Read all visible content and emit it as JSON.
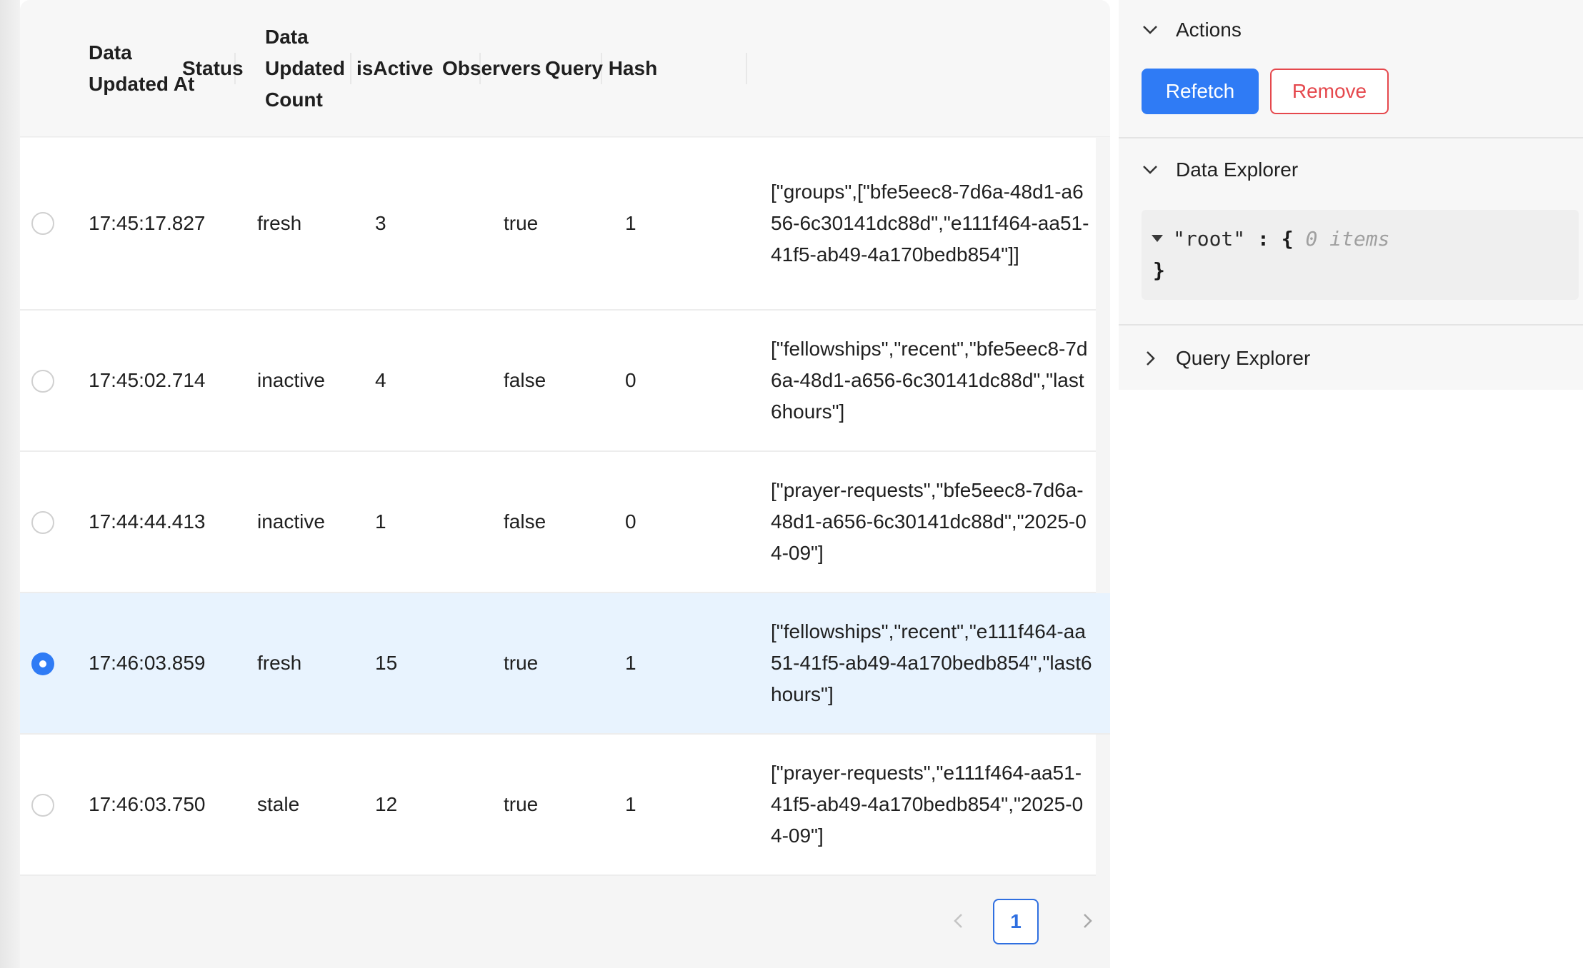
{
  "table": {
    "columns": [
      {
        "key": "updated_at",
        "label": "Data\nUpdated At"
      },
      {
        "key": "status",
        "label": "Status"
      },
      {
        "key": "count",
        "label": "Data\nUpdated\nCount"
      },
      {
        "key": "active",
        "label": "isActive"
      },
      {
        "key": "observers",
        "label": "Observers"
      },
      {
        "key": "hash",
        "label": "Query Hash"
      }
    ],
    "header": {
      "updated_at_1": "Data",
      "updated_at_2": "Updated At",
      "status": "Status",
      "count_1": "Data",
      "count_2": "Updated",
      "count_3": "Count",
      "active": "isActive",
      "observers": "Observers",
      "hash": "Query Hash"
    },
    "rows": [
      {
        "selected": false,
        "updated_at": "17:45:17.827",
        "status": "fresh",
        "count": "3",
        "active": "true",
        "observers": "1",
        "hash": "[\"groups\",[\"bfe5eec8-7d6a-48d1-a656-6c30141dc88d\",\"e111f464-aa51-41f5-ab49-4a170bedb854\"]]"
      },
      {
        "selected": false,
        "updated_at": "17:45:02.714",
        "status": "inactive",
        "count": "4",
        "active": "false",
        "observers": "0",
        "hash": "[\"fellowships\",\"recent\",\"bfe5eec8-7d6a-48d1-a656-6c30141dc88d\",\"last6hours\"]"
      },
      {
        "selected": false,
        "updated_at": "17:44:44.413",
        "status": "inactive",
        "count": "1",
        "active": "false",
        "observers": "0",
        "hash": "[\"prayer-requests\",\"bfe5eec8-7d6a-48d1-a656-6c30141dc88d\",\"2025-04-09\"]"
      },
      {
        "selected": true,
        "updated_at": "17:46:03.859",
        "status": "fresh",
        "count": "15",
        "active": "true",
        "observers": "1",
        "hash": "[\"fellowships\",\"recent\",\"e111f464-aa51-41f5-ab49-4a170bedb854\",\"last6hours\"]"
      },
      {
        "selected": false,
        "updated_at": "17:46:03.750",
        "status": "stale",
        "count": "12",
        "active": "true",
        "observers": "1",
        "hash": "[\"prayer-requests\",\"e111f464-aa51-41f5-ab49-4a170bedb854\",\"2025-04-09\"]"
      }
    ]
  },
  "pagination": {
    "current_page": "1",
    "prev_icon": "chevron-left-icon",
    "next_icon": "chevron-right-icon"
  },
  "sidebar": {
    "actions": {
      "title": "Actions",
      "refetch_label": "Refetch",
      "remove_label": "Remove"
    },
    "data_explorer": {
      "title": "Data Explorer",
      "root_key": "\"root\"",
      "colon": " : ",
      "open_brace": "{",
      "item_count": " 0 items",
      "close_brace": "}"
    },
    "query_explorer": {
      "title": "Query Explorer"
    }
  },
  "colors": {
    "primary": "#2f7bf5",
    "danger": "#e5484d",
    "selected_row": "#e8f3fe"
  }
}
